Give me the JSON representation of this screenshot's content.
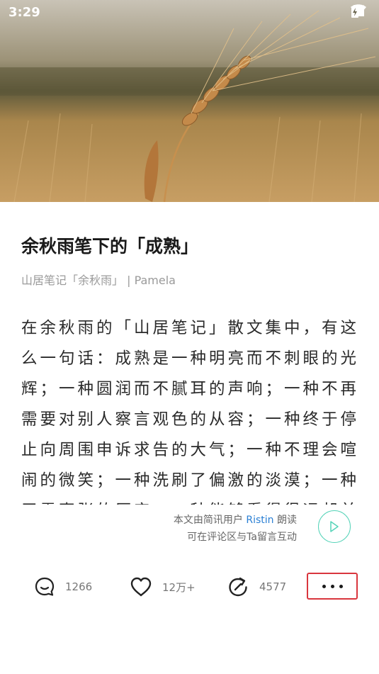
{
  "status_bar": {
    "time": "3:29"
  },
  "hero": {
    "image_icon": "wheat-field-photo"
  },
  "article": {
    "title": "余秋雨笔下的「成熟」",
    "meta": "山居笔记「余秋雨」 | Pamela",
    "body": "在余秋雨的「山居笔记」散文集中，有这么一句话：成熟是一种明亮而不刺眼的光辉；一种圆润而不腻耳的声响；一种不再需要对别人察言观色的从容；一种终于停止向周围申诉求告的大气；一种不理会喧闹的微笑；一种洗刷了偏激的淡漠；一种无需声张的厚实；一种能够看得很远却并不陡峭的高度。"
  },
  "narration": {
    "prefix": "本文由简讯用户 ",
    "user": "Ristin",
    "suffix": " 朗读",
    "line2": "可在评论区与Ta留言互动"
  },
  "actions": {
    "comments": "1266",
    "likes": "12万+",
    "shares": "4577"
  },
  "colors": {
    "accent_play": "#55d3b8",
    "link_user": "#2a7fd4",
    "highlight_border": "#d9363e"
  }
}
